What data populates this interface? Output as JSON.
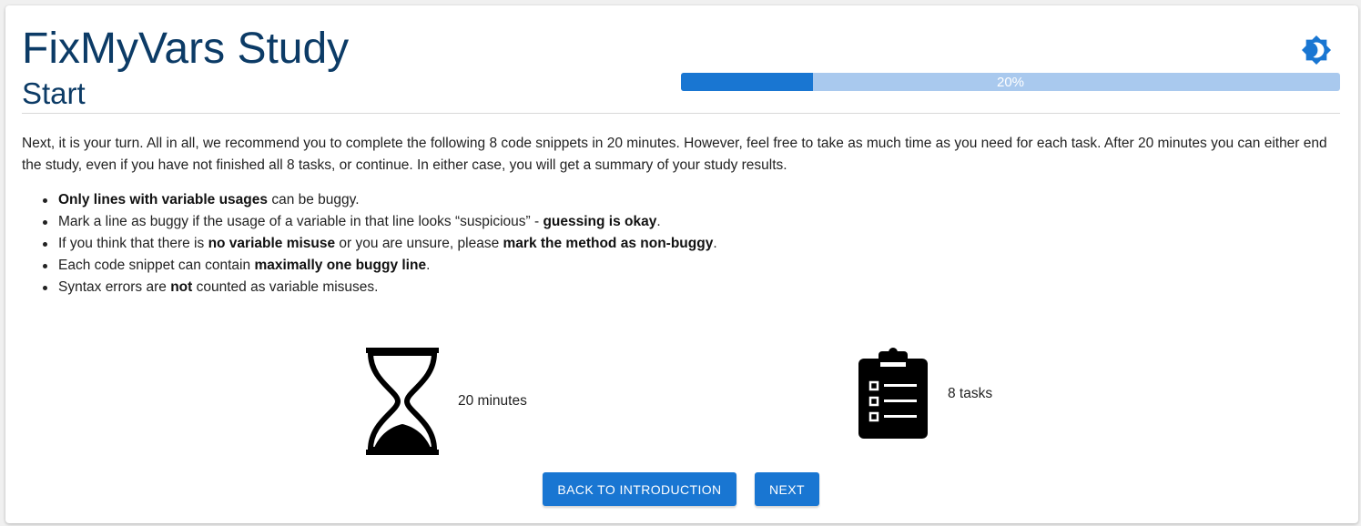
{
  "header": {
    "title": "FixMyVars Study",
    "subtitle": "Start",
    "theme_toggle_icon": "brightness-icon"
  },
  "progress": {
    "value": 0.2,
    "label": "20%",
    "fill_color": "#1976d2",
    "track_color": "#a9c9ee"
  },
  "intro": {
    "text": "Next, it is your turn. All in all, we recommend you to complete the following 8 code snippets in 20 minutes. However, feel free to take as much time as you need for each task. After 20 minutes you can either end the study, even if you have not finished all 8 tasks, or continue. In either case, you will get a summary of your study results."
  },
  "rules": [
    {
      "b1": "Only lines with variable usages",
      "t1": " can be buggy.",
      "b2": "",
      "t2": ""
    },
    {
      "b1": "",
      "t1": "Mark a line as buggy if the usage of a variable in that line looks “suspicious” - ",
      "b2": "guessing is okay",
      "t2": "."
    },
    {
      "b1": "",
      "t1": "If you think that there is ",
      "b2": "no variable misuse",
      "t2": " or you are unsure, please ",
      "b3": "mark the method as non-buggy",
      "t3": "."
    },
    {
      "b1": "",
      "t1": "Each code snippet can contain ",
      "b2": "maximally one buggy line",
      "t2": "."
    },
    {
      "b1": "",
      "t1": "Syntax errors are ",
      "b2": "not",
      "t2": " counted as variable misuses."
    }
  ],
  "info": {
    "time_icon": "hourglass-icon",
    "time_label": "20 minutes",
    "tasks_icon": "clipboard-list-icon",
    "tasks_label": "8 tasks"
  },
  "buttons": {
    "back_label": "Back to introduction",
    "next_label": "Next",
    "color": "#1976d2"
  },
  "colors": {
    "title": "#0c3b66",
    "accent": "#1976d2"
  }
}
